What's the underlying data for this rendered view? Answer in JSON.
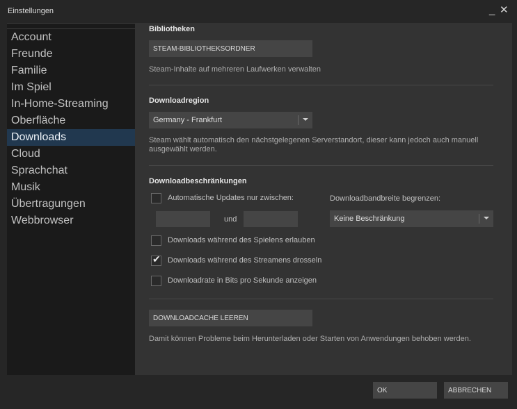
{
  "window": {
    "title": "Einstellungen",
    "minimize_glyph": "_",
    "close_glyph": "✕"
  },
  "sidebar": {
    "items": [
      {
        "label": "Account"
      },
      {
        "label": "Freunde"
      },
      {
        "label": "Familie"
      },
      {
        "label": "Im Spiel"
      },
      {
        "label": "In-Home-Streaming"
      },
      {
        "label": "Oberfläche"
      },
      {
        "label": "Downloads",
        "active": true
      },
      {
        "label": "Cloud"
      },
      {
        "label": "Sprachchat"
      },
      {
        "label": "Musik"
      },
      {
        "label": "Übertragungen"
      },
      {
        "label": "Webbrowser"
      }
    ]
  },
  "libraries": {
    "heading": "Bibliotheken",
    "button_label": "STEAM-BIBLIOTHEKSORDNER",
    "description": "Steam-Inhalte auf mehreren Laufwerken verwalten"
  },
  "region": {
    "heading": "Downloadregion",
    "selected": "Germany - Frankfurt",
    "description_line1": "Steam wählt automatisch den nächstgelegenen Serverstandort, dieser kann jedoch auch manuell",
    "description_line2": "ausgewählt werden."
  },
  "restrictions": {
    "heading": "Downloadbeschränkungen",
    "auto_update_label": "Automatische Updates nur zwischen:",
    "auto_update_checked": false,
    "time_from": "",
    "time_to": "",
    "and_label": "und",
    "bandwidth_label": "Downloadbandbreite begrenzen:",
    "bandwidth_selected": "Keine Beschränkung",
    "options": [
      {
        "label": "Downloads während des Spielens erlauben",
        "checked": false
      },
      {
        "label": "Downloads während des Streamens drosseln",
        "checked": true
      },
      {
        "label": "Downloadrate in Bits pro Sekunde anzeigen",
        "checked": false
      }
    ]
  },
  "cache": {
    "button_label": "DOWNLOADCACHE LEEREN",
    "description": "Damit können Probleme beim Herunterladen oder Starten von Anwendungen behoben werden."
  },
  "footer": {
    "ok_label": "OK",
    "cancel_label": "ABBRECHEN"
  },
  "colors": {
    "background": "#262626",
    "sidebar": "#1a1a1a",
    "panel": "#333333",
    "active_item": "#21384f",
    "control": "#454545"
  },
  "icons": {
    "dropdown": "chevron-down-icon",
    "check": "checkmark-icon"
  }
}
